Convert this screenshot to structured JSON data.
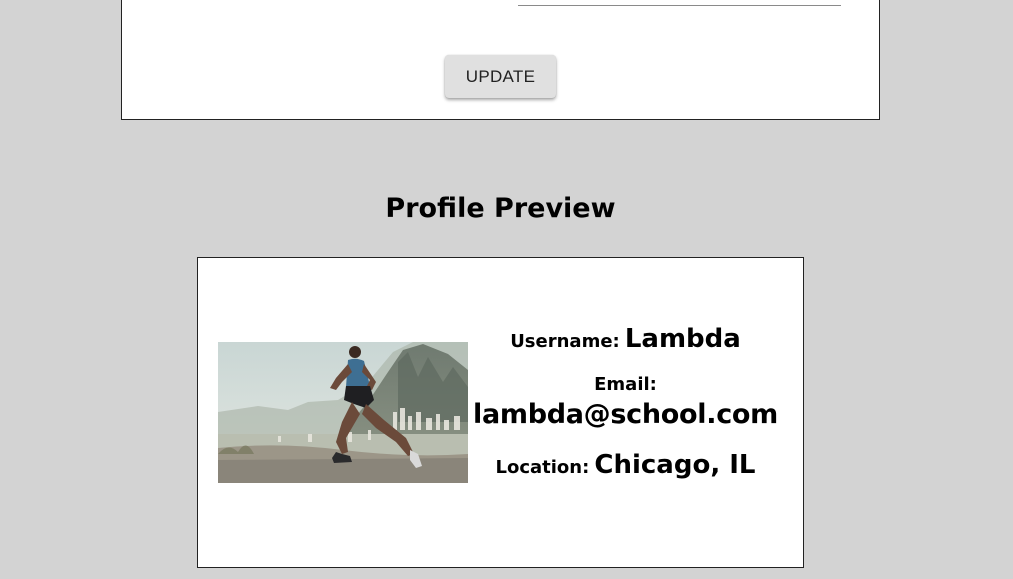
{
  "form": {
    "update_label": "UPDATE"
  },
  "preview": {
    "title": "Profile Preview",
    "photo_icon": "runner-photo",
    "username_label": "Username:",
    "username_value": "Lambda",
    "email_label": "Email:",
    "email_value": "lambda@school.com",
    "location_label": "Location:",
    "location_value": "Chicago, IL"
  }
}
